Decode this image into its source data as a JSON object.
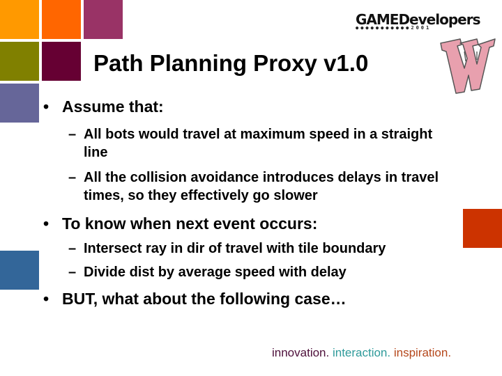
{
  "slide": {
    "title": "Path Planning Proxy v1.0",
    "branding": {
      "logo_text": "GAMEDevelopers",
      "logo_subtext": "conference 2001",
      "university_logo": "w-logo-icon"
    },
    "decor_colors": {
      "orange": "#FF9900",
      "dark_orange": "#FF6600",
      "magenta": "#993366",
      "olive": "#808000",
      "maroon": "#660033",
      "slate_blue": "#666699",
      "steel_blue": "#336699",
      "red_orange": "#CC3300"
    },
    "bullets": [
      {
        "text": "Assume that:",
        "subitems": [
          "All bots would travel at maximum speed in a straight line",
          "All the collision avoidance introduces delays in travel times, so they effectively go slower"
        ]
      },
      {
        "text": "To know when next event occurs:",
        "subitems": [
          "Intersect ray in dir of travel with tile boundary",
          "Divide dist by average speed with delay"
        ]
      },
      {
        "text": "BUT, what about the following case…",
        "subitems": []
      }
    ],
    "bullet_glyph": "•",
    "sub_glyph": "–",
    "tagline": [
      {
        "text": "innovation.",
        "color": "#4D0F3A"
      },
      {
        "text": " interaction.",
        "color": "#2E9A9A"
      },
      {
        "text": " inspiration.",
        "color": "#B5471B"
      }
    ]
  }
}
